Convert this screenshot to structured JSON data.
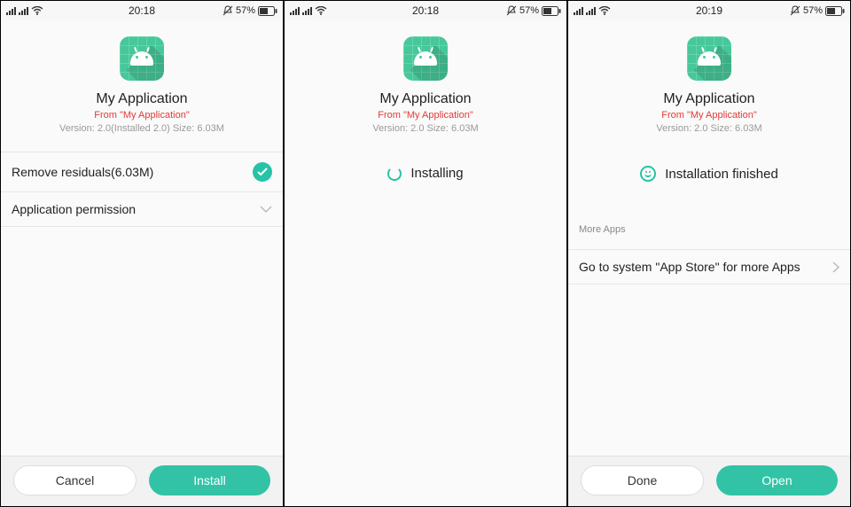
{
  "screens": [
    {
      "status": {
        "time": "20:18",
        "battery_pct": "57%"
      },
      "app": {
        "name": "My Application",
        "from": "From \"My Application\"",
        "meta": "Version: 2.0(Installed 2.0)   Size: 6.03M"
      },
      "rows": {
        "residuals": "Remove residuals(6.03M)",
        "permission": "Application permission"
      },
      "footer": {
        "left": "Cancel",
        "right": "Install"
      }
    },
    {
      "status": {
        "time": "20:18",
        "battery_pct": "57%"
      },
      "app": {
        "name": "My Application",
        "from": "From \"My Application\"",
        "meta": "Version: 2.0   Size: 6.03M"
      },
      "center": {
        "text": "Installing"
      }
    },
    {
      "status": {
        "time": "20:19",
        "battery_pct": "57%"
      },
      "app": {
        "name": "My Application",
        "from": "From \"My Application\"",
        "meta": "Version: 2.0   Size: 6.03M"
      },
      "center": {
        "text": "Installation finished"
      },
      "more": {
        "label": "More Apps",
        "row": "Go to system \"App Store\" for more Apps"
      },
      "footer": {
        "left": "Done",
        "right": "Open"
      }
    }
  ]
}
